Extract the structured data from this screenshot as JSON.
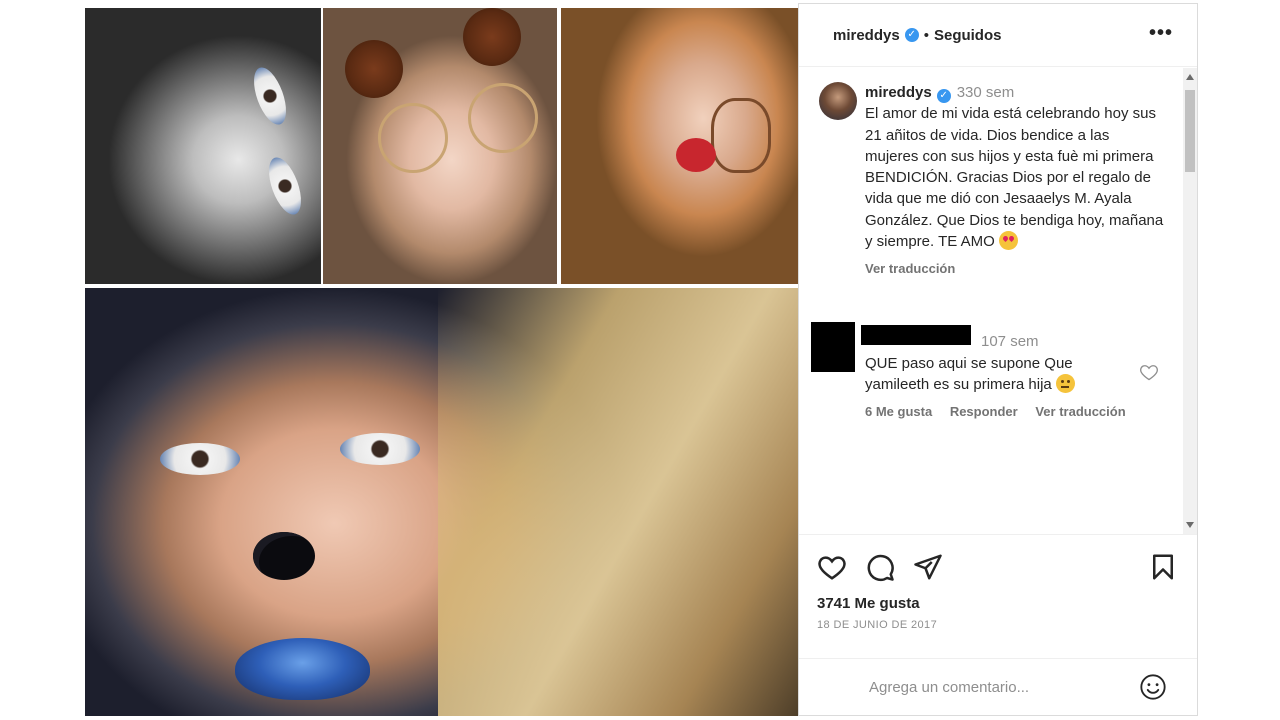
{
  "header": {
    "username": "mireddys",
    "separator": "•",
    "follow_status": "Seguidos",
    "more_label": "•••"
  },
  "caption": {
    "username": "mireddys",
    "time": "330 sem",
    "text": "El amor de mi vida está celebrando hoy sus 21 añitos de vida. Dios bendice a las mujeres con sus hijos y esta fuè mi primera BENDICIÓN. Gracias Dios por el regalo de vida que me dió con Jesaaelys M. Ayala González. Que Dios te bendiga hoy, mañana y siempre. TE AMO",
    "emoji": "heart-eyes-emoji",
    "translate": "Ver traducción"
  },
  "comments": [
    {
      "time": "107 sem",
      "text": "QUE paso aqui se supone Que yamileeth es su primera hija",
      "emoji": "thinking-emoji",
      "likes": "6 Me gusta",
      "reply": "Responder",
      "translate": "Ver traducción"
    }
  ],
  "post": {
    "likes": "3741 Me gusta",
    "date": "18 DE JUNIO DE 2017"
  },
  "comment_box": {
    "placeholder": "Agrega un comentario..."
  },
  "colors": {
    "verified": "#3897f0",
    "text": "#262626",
    "secondary": "#8e8e8e",
    "border": "#dbdbdb"
  },
  "icons": {
    "like": "heart-icon",
    "comment": "comment-bubble-icon",
    "share": "paper-plane-icon",
    "save": "bookmark-icon",
    "emoji": "smiley-icon",
    "more": "more-options-icon",
    "verified": "verified-badge-icon"
  }
}
